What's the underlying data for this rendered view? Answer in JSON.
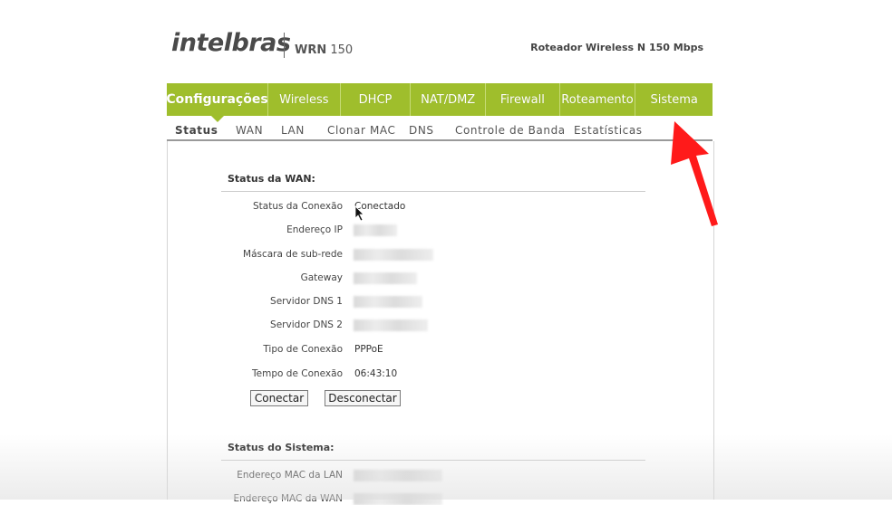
{
  "header": {
    "logo": "intelbras",
    "model_prefix": "WRN",
    "model_number": "150",
    "subtitle": "Roteador Wireless N 150 Mbps"
  },
  "main_nav": [
    {
      "label": "Configurações",
      "active": true
    },
    {
      "label": "Wireless",
      "active": false
    },
    {
      "label": "DHCP",
      "active": false
    },
    {
      "label": "NAT/DMZ",
      "active": false
    },
    {
      "label": "Firewall",
      "active": false
    },
    {
      "label": "Roteamento",
      "active": false
    },
    {
      "label": "Sistema",
      "active": false
    }
  ],
  "sub_nav": [
    {
      "label": "Status",
      "active": true
    },
    {
      "label": "WAN",
      "active": false
    },
    {
      "label": "LAN",
      "active": false
    },
    {
      "label": "Clonar MAC",
      "active": false
    },
    {
      "label": "DNS",
      "active": false
    },
    {
      "label": "Controle de Banda",
      "active": false
    },
    {
      "label": "Estatísticas",
      "active": false
    }
  ],
  "wan_status": {
    "title": "Status da WAN:",
    "rows": [
      {
        "label": "Status da Conexão",
        "value": "Conectado",
        "blurred": false
      },
      {
        "label": "Endereço IP",
        "value": "",
        "blurred": true
      },
      {
        "label": "Máscara de sub-rede",
        "value": "",
        "blurred": true
      },
      {
        "label": "Gateway",
        "value": "",
        "blurred": true
      },
      {
        "label": "Servidor DNS 1",
        "value": "",
        "blurred": true
      },
      {
        "label": "Servidor DNS 2",
        "value": "",
        "blurred": true
      },
      {
        "label": "Tipo de Conexão",
        "value": "PPPoE",
        "blurred": false
      },
      {
        "label": "Tempo de Conexão",
        "value": "06:43:10",
        "blurred": false
      }
    ],
    "connect_button": "Conectar",
    "disconnect_button": "Desconectar"
  },
  "system_status": {
    "title": "Status do Sistema:",
    "rows": [
      {
        "label": "Endereço MAC da LAN",
        "value": "",
        "blurred": true
      },
      {
        "label": "Endereço MAC da WAN",
        "value": "",
        "blurred": true
      }
    ]
  },
  "colors": {
    "nav_green": "#9fbe2c",
    "annotation_arrow": "#ff1a1a"
  },
  "icons": {
    "cursor": "mouse-pointer-icon",
    "annotation": "red-arrow-icon"
  }
}
